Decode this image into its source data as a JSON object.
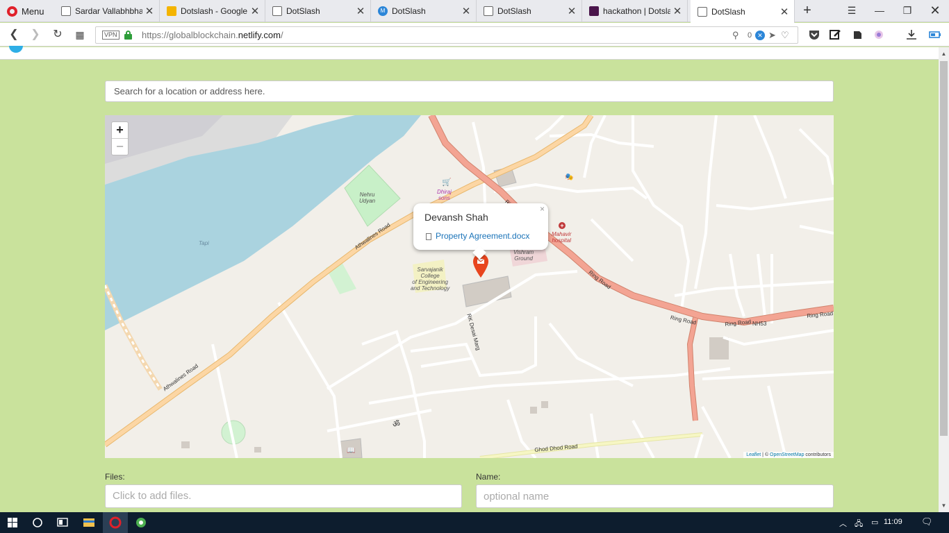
{
  "browser": {
    "menu_label": "Menu",
    "tabs": [
      {
        "title": "Sardar Vallabhbhai",
        "favicon": "doc-icon"
      },
      {
        "title": "Dotslash - Google",
        "favicon": "slides-icon"
      },
      {
        "title": "DotSlash",
        "favicon": "doc-icon"
      },
      {
        "title": "DotSlash",
        "favicon": "m-icon"
      },
      {
        "title": "DotSlash",
        "favicon": "doc-icon"
      },
      {
        "title": "hackathon | Dotsla",
        "favicon": "slack-icon"
      },
      {
        "title": "DotSlash",
        "favicon": "doc-icon",
        "active": true
      }
    ],
    "url_prefix": "https://globalblockchain.",
    "url_domain": "netlify.com",
    "url_suffix": "/",
    "vpn_label": "VPN",
    "tracker_count": "0"
  },
  "page": {
    "search_placeholder": "Search for a location or address here.",
    "map": {
      "popup": {
        "name": "Devansh Shah",
        "file": "Property Agreement.docx",
        "close": "×"
      },
      "zoom_in": "+",
      "zoom_out": "−",
      "attribution_leaflet": "Leaflet",
      "attribution_sep": " | © ",
      "attribution_osm": "OpenStreetMap",
      "attribution_tail": " contributors",
      "labels": {
        "nehru": "Nehru\nUdyan",
        "dhiraj": "Dhiraj\nsons",
        "tapi": "Tapi",
        "mahavir": "Mahavir\nhospital",
        "vishram": "Vishram\nGround",
        "college": "Sarvajanik\nCollege\nof Engineering\nand Technology",
        "athwalines_1": "Athwalines Road",
        "athwalines_2": "Athwalines Road",
        "rk_desai": "RK Desai Marg",
        "ring_1": "Ring Road",
        "ring_2": "Ring Road",
        "ring_3": "Ring Road",
        "ring_4": "Ring Road",
        "nh53": "NH53",
        "ghod_dhod": "Ghod Dhod Road"
      }
    },
    "files_label": "Files:",
    "files_placeholder": "Click to add files.",
    "name_label": "Name:",
    "name_placeholder": "optional name"
  },
  "taskbar": {
    "clock": "11:09"
  },
  "colors": {
    "page_bg": "#c9e29c",
    "river": "#aad3df",
    "ring_road": "#f3a493",
    "athwalines_road": "#fcd6a4",
    "link_blue": "#1a73b8",
    "marker": "#e8451e"
  }
}
